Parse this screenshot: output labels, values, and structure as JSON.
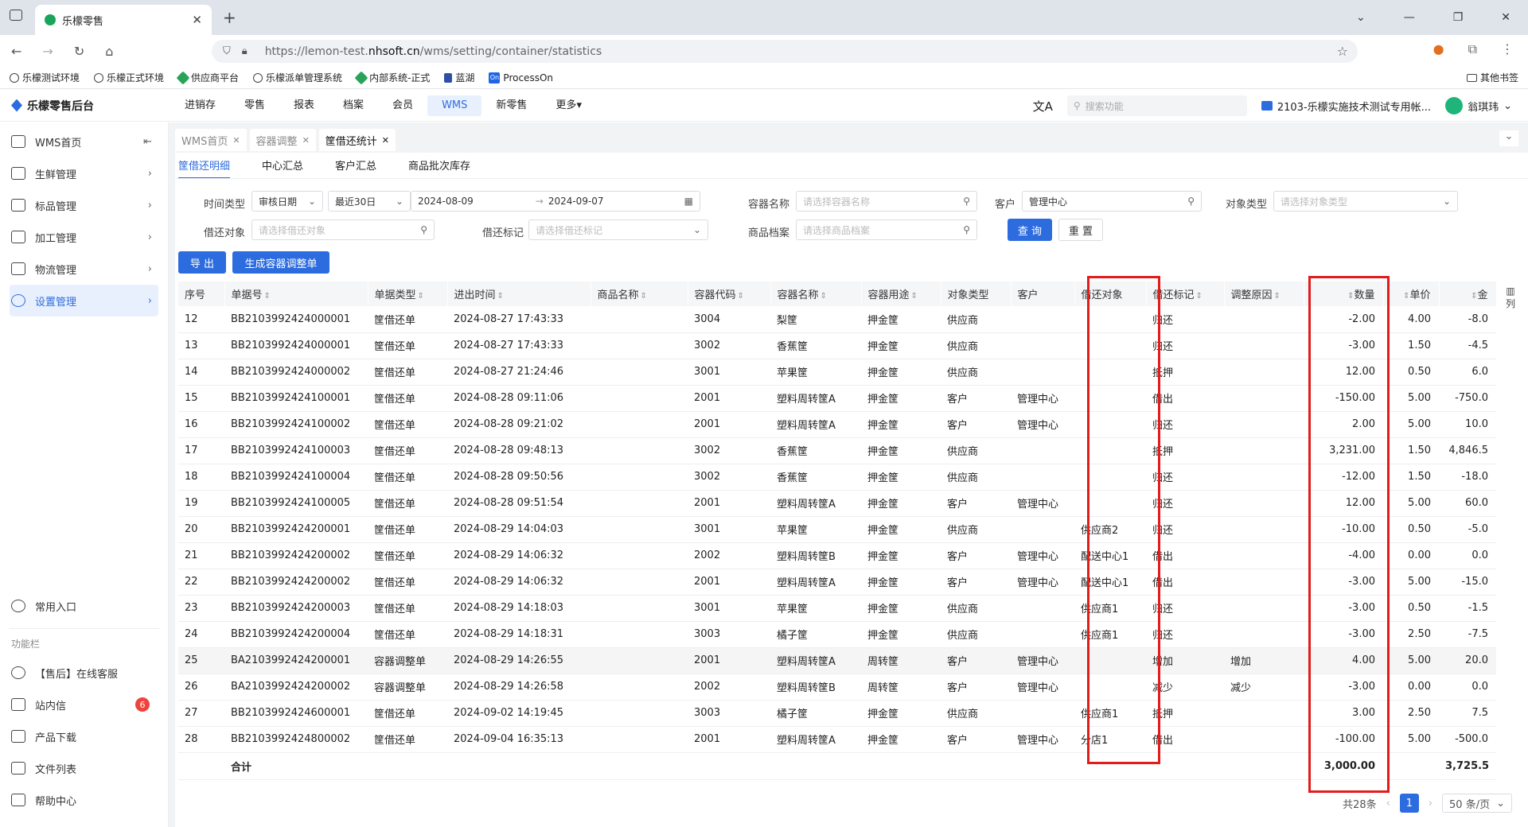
{
  "browser": {
    "tab_title": "乐檬零售",
    "url_prefix": "https://lemon-test.",
    "url_domain": "nhsoft.cn",
    "url_path": "/wms/setting/container/statistics",
    "bookmarks": [
      "乐檬测试环境",
      "乐檬正式环境",
      "供应商平台",
      "乐檬派单管理系统",
      "内部系统-正式",
      "蓝湖",
      "ProcessOn"
    ],
    "other_bookmarks": "其他书签"
  },
  "app": {
    "logo": "乐檬零售后台",
    "nav": [
      "进销存",
      "零售",
      "报表",
      "档案",
      "会员",
      "WMS",
      "新零售",
      "更多"
    ],
    "active_nav": "WMS",
    "search_placeholder": "搜索功能",
    "org": "2103-乐檬实施技术测试专用帐...",
    "user": "翁琪玮"
  },
  "sidebar": {
    "items": [
      "WMS首页",
      "生鲜管理",
      "标品管理",
      "加工管理",
      "物流管理",
      "设置管理"
    ],
    "active": "设置管理",
    "common": "常用入口",
    "section": "功能栏",
    "bottom": [
      "【售后】在线客服",
      "站内信",
      "产品下载",
      "文件列表",
      "帮助中心"
    ],
    "badge": "6"
  },
  "page_tabs": [
    "WMS首页",
    "容器调整",
    "筐借还统计"
  ],
  "sub_tabs": [
    "筐借还明细",
    "中心汇总",
    "客户汇总",
    "商品批次库存"
  ],
  "filters": {
    "time_type_label": "时间类型",
    "time_type": "审核日期",
    "range": "最近30日",
    "date_from": "2024-08-09",
    "date_to": "2024-09-07",
    "container_name_label": "容器名称",
    "container_name_ph": "请选择容器名称",
    "customer_label": "客户",
    "customer": "管理中心",
    "object_type_label": "对象类型",
    "object_type_ph": "请选择对象类型",
    "object_label": "借还对象",
    "object_ph": "请选择借还对象",
    "mark_label": "借还标记",
    "mark_ph": "请选择借还标记",
    "goods_label": "商品档案",
    "goods_ph": "请选择商品档案",
    "query": "查 询",
    "reset": "重 置",
    "export": "导 出",
    "gen": "生成容器调整单"
  },
  "table": {
    "columns": [
      "序号",
      "单据号",
      "单据类型",
      "进出时间",
      "商品名称",
      "容器代码",
      "容器名称",
      "容器用途",
      "对象类型",
      "客户",
      "借还对象",
      "借还标记",
      "调整原因",
      "数量",
      "单价",
      "金"
    ],
    "rows": [
      [
        "12",
        "BB2103992424000001",
        "筐借还单",
        "2024-08-27 17:43:33",
        "",
        "3004",
        "梨筐",
        "押金筐",
        "供应商",
        "",
        "",
        "归还",
        "",
        "-2.00",
        "4.00",
        "-8.0"
      ],
      [
        "13",
        "BB2103992424000001",
        "筐借还单",
        "2024-08-27 17:43:33",
        "",
        "3002",
        "香蕉筐",
        "押金筐",
        "供应商",
        "",
        "",
        "归还",
        "",
        "-3.00",
        "1.50",
        "-4.5"
      ],
      [
        "14",
        "BB2103992424000002",
        "筐借还单",
        "2024-08-27 21:24:46",
        "",
        "3001",
        "苹果筐",
        "押金筐",
        "供应商",
        "",
        "",
        "抵押",
        "",
        "12.00",
        "0.50",
        "6.0"
      ],
      [
        "15",
        "BB2103992424100001",
        "筐借还单",
        "2024-08-28 09:11:06",
        "",
        "2001",
        "塑料周转筐A",
        "押金筐",
        "客户",
        "管理中心",
        "",
        "借出",
        "",
        "-150.00",
        "5.00",
        "-750.0"
      ],
      [
        "16",
        "BB2103992424100002",
        "筐借还单",
        "2024-08-28 09:21:02",
        "",
        "2001",
        "塑料周转筐A",
        "押金筐",
        "客户",
        "管理中心",
        "",
        "归还",
        "",
        "2.00",
        "5.00",
        "10.0"
      ],
      [
        "17",
        "BB2103992424100003",
        "筐借还单",
        "2024-08-28 09:48:13",
        "",
        "3002",
        "香蕉筐",
        "押金筐",
        "供应商",
        "",
        "",
        "抵押",
        "",
        "3,231.00",
        "1.50",
        "4,846.5"
      ],
      [
        "18",
        "BB2103992424100004",
        "筐借还单",
        "2024-08-28 09:50:56",
        "",
        "3002",
        "香蕉筐",
        "押金筐",
        "供应商",
        "",
        "",
        "归还",
        "",
        "-12.00",
        "1.50",
        "-18.0"
      ],
      [
        "19",
        "BB2103992424100005",
        "筐借还单",
        "2024-08-28 09:51:54",
        "",
        "2001",
        "塑料周转筐A",
        "押金筐",
        "客户",
        "管理中心",
        "",
        "归还",
        "",
        "12.00",
        "5.00",
        "60.0"
      ],
      [
        "20",
        "BB2103992424200001",
        "筐借还单",
        "2024-08-29 14:04:03",
        "",
        "3001",
        "苹果筐",
        "押金筐",
        "供应商",
        "",
        "供应商2",
        "归还",
        "",
        "-10.00",
        "0.50",
        "-5.0"
      ],
      [
        "21",
        "BB2103992424200002",
        "筐借还单",
        "2024-08-29 14:06:32",
        "",
        "2002",
        "塑料周转筐B",
        "押金筐",
        "客户",
        "管理中心",
        "配送中心1",
        "借出",
        "",
        "-4.00",
        "0.00",
        "0.0"
      ],
      [
        "22",
        "BB2103992424200002",
        "筐借还单",
        "2024-08-29 14:06:32",
        "",
        "2001",
        "塑料周转筐A",
        "押金筐",
        "客户",
        "管理中心",
        "配送中心1",
        "借出",
        "",
        "-3.00",
        "5.00",
        "-15.0"
      ],
      [
        "23",
        "BB2103992424200003",
        "筐借还单",
        "2024-08-29 14:18:03",
        "",
        "3001",
        "苹果筐",
        "押金筐",
        "供应商",
        "",
        "供应商1",
        "归还",
        "",
        "-3.00",
        "0.50",
        "-1.5"
      ],
      [
        "24",
        "BB2103992424200004",
        "筐借还单",
        "2024-08-29 14:18:31",
        "",
        "3003",
        "橘子筐",
        "押金筐",
        "供应商",
        "",
        "供应商1",
        "归还",
        "",
        "-3.00",
        "2.50",
        "-7.5"
      ],
      [
        "25",
        "BA2103992424200001",
        "容器调整单",
        "2024-08-29 14:26:55",
        "",
        "2001",
        "塑料周转筐A",
        "周转筐",
        "客户",
        "管理中心",
        "",
        "增加",
        "增加",
        "4.00",
        "5.00",
        "20.0"
      ],
      [
        "26",
        "BA2103992424200002",
        "容器调整单",
        "2024-08-29 14:26:58",
        "",
        "2002",
        "塑料周转筐B",
        "周转筐",
        "客户",
        "管理中心",
        "",
        "减少",
        "减少",
        "-3.00",
        "0.00",
        "0.0"
      ],
      [
        "27",
        "BB2103992424600001",
        "筐借还单",
        "2024-09-02 14:19:45",
        "",
        "3003",
        "橘子筐",
        "押金筐",
        "供应商",
        "",
        "供应商1",
        "抵押",
        "",
        "3.00",
        "2.50",
        "7.5"
      ],
      [
        "28",
        "BB2103992424800002",
        "筐借还单",
        "2024-09-04 16:35:13",
        "",
        "2001",
        "塑料周转筐A",
        "押金筐",
        "客户",
        "管理中心",
        "分店1",
        "借出",
        "",
        "-100.00",
        "5.00",
        "-500.0"
      ]
    ],
    "total_label": "合计",
    "total_qty": "3,000.00",
    "total_amount": "3,725.5",
    "col_settings": "列"
  },
  "pager": {
    "total": "共28条",
    "page": "1",
    "size": "50 条/页"
  },
  "colors": {
    "accent": "#2d6cdf",
    "highlight_box": "#e31b1b"
  }
}
